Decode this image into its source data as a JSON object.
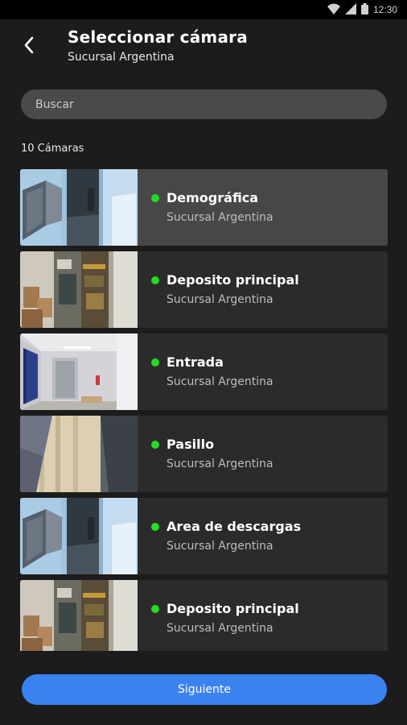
{
  "status_bar": {
    "time": "12:30"
  },
  "header": {
    "title": "Seleccionar cámara",
    "subtitle": "Sucursal Argentina"
  },
  "search": {
    "placeholder": "Buscar"
  },
  "list_count": "10 Cámaras",
  "cameras": [
    {
      "name": "Demográfica",
      "location": "Sucursal Argentina",
      "status": "online",
      "selected": true,
      "thumb": "storage-room"
    },
    {
      "name": "Deposito principal",
      "location": "Sucursal Argentina",
      "status": "online",
      "selected": false,
      "thumb": "stock-room"
    },
    {
      "name": "Entrada",
      "location": "Sucursal Argentina",
      "status": "online",
      "selected": false,
      "thumb": "entrance"
    },
    {
      "name": "Pasillo",
      "location": "Sucursal Argentina",
      "status": "online",
      "selected": false,
      "thumb": "hallway"
    },
    {
      "name": "Area de descargas",
      "location": "Sucursal Argentina",
      "status": "online",
      "selected": false,
      "thumb": "storage-room"
    },
    {
      "name": "Deposito principal",
      "location": "Sucursal Argentina",
      "status": "online",
      "selected": false,
      "thumb": "stock-room"
    }
  ],
  "colors": {
    "online": "#22dd22",
    "accent": "#3b82f1"
  },
  "footer": {
    "next_label": "Siguiente"
  }
}
